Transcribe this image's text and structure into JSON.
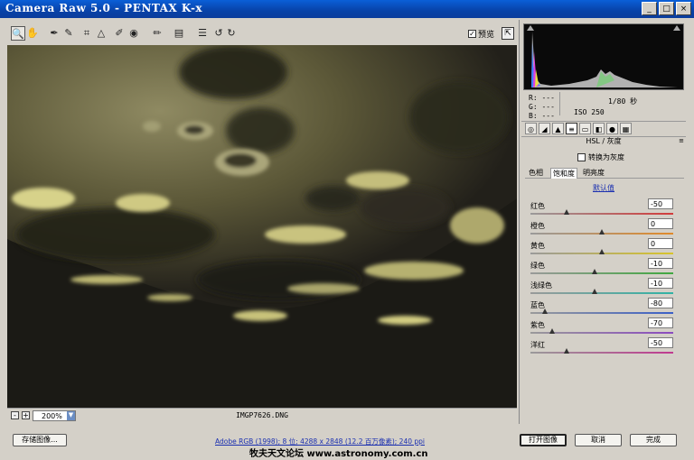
{
  "window": {
    "title": "Camera Raw 5.0 -  PENTAX K-x",
    "minimize": "_",
    "maximize": "□",
    "close": "×"
  },
  "toolbar": {
    "tools": [
      {
        "name": "zoom-tool-icon",
        "glyph": "🔍"
      },
      {
        "name": "hand-tool-icon",
        "glyph": "✋"
      },
      {
        "name": "white-balance-tool-icon",
        "glyph": "✒"
      },
      {
        "name": "color-sampler-tool-icon",
        "glyph": "✎"
      },
      {
        "name": "crop-tool-icon",
        "glyph": "⌗"
      },
      {
        "name": "straighten-tool-icon",
        "glyph": "△"
      },
      {
        "name": "spot-removal-tool-icon",
        "glyph": "✐"
      },
      {
        "name": "red-eye-tool-icon",
        "glyph": "◉"
      },
      {
        "name": "adjustment-brush-icon",
        "glyph": "✏"
      },
      {
        "name": "graduated-filter-icon",
        "glyph": "▤"
      },
      {
        "name": "preferences-icon",
        "glyph": "☰"
      },
      {
        "name": "rotate-left-icon",
        "glyph": "↺"
      },
      {
        "name": "rotate-right-icon",
        "glyph": "↻"
      }
    ],
    "preview_checked": "✓",
    "preview_label": "预览",
    "fullscreen_glyph": "⇱"
  },
  "status": {
    "zoom_out": "-",
    "zoom_in": "+",
    "zoom_value": "200%",
    "zoom_dropdown": "▼",
    "filename": "IMGP7626.DNG"
  },
  "readout": {
    "r": "R:  ---",
    "g": "G:  ---",
    "b": "B:  ---",
    "shutter": "1/80 秒",
    "iso": "ISO 250"
  },
  "panel": {
    "tabs": [
      "◎",
      "◢",
      "▲",
      "≡",
      "▭",
      "◧",
      "●",
      "▦"
    ],
    "active_tab": 3,
    "title": "HSL / 灰度",
    "menu_glyph": "≡",
    "grayscale_label": "转换为灰度",
    "subtabs": [
      "色相",
      "饱和度",
      "明亮度"
    ],
    "active_subtab": 1,
    "default_link": "默认值",
    "sliders": [
      {
        "label": "红色",
        "value": "-50",
        "num": -50,
        "color": "#d23b3b"
      },
      {
        "label": "橙色",
        "value": "0",
        "num": 0,
        "color": "#e08a2a"
      },
      {
        "label": "黄色",
        "value": "0",
        "num": 0,
        "color": "#d8c42a"
      },
      {
        "label": "绿色",
        "value": "-10",
        "num": -10,
        "color": "#3fa83f"
      },
      {
        "label": "浅绿色",
        "value": "-10",
        "num": -10,
        "color": "#2fb3a5"
      },
      {
        "label": "蓝色",
        "value": "-80",
        "num": -80,
        "color": "#3a5fc8"
      },
      {
        "label": "紫色",
        "value": "-70",
        "num": -70,
        "color": "#8a4ac0"
      },
      {
        "label": "洋红",
        "value": "-50",
        "num": -50,
        "color": "#c03a90"
      }
    ]
  },
  "bottom": {
    "save_label": "存储图像...",
    "info_link": "Adobe RGB (1998); 8 位; 4288 x 2848 (12.2 百万像素); 240 ppi",
    "open_label": "打开图像",
    "cancel_label": "取消",
    "done_label": "完成",
    "watermark": "牧夫天文论坛 www.astronomy.com.cn"
  }
}
